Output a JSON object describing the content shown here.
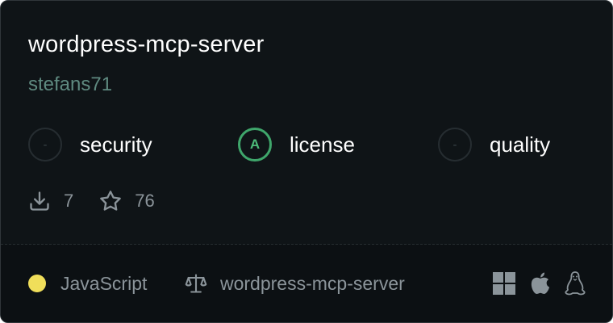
{
  "server": {
    "name": "wordpress-mcp-server",
    "author": "stefans71"
  },
  "scores": [
    {
      "grade": "-",
      "label": "security"
    },
    {
      "grade": "A",
      "label": "license"
    },
    {
      "grade": "-",
      "label": "quality"
    }
  ],
  "stats": {
    "downloads": "7",
    "stars": "76"
  },
  "footer": {
    "language": "JavaScript",
    "language_color": "#f0de5a",
    "license_repo": "wordpress-mcp-server",
    "platforms": [
      "windows-icon",
      "apple-icon",
      "linux-icon"
    ]
  },
  "colors": {
    "background": "#0f1417",
    "author": "#5f8a80",
    "grade_a": "#3fa66b",
    "muted": "#8b949a"
  }
}
